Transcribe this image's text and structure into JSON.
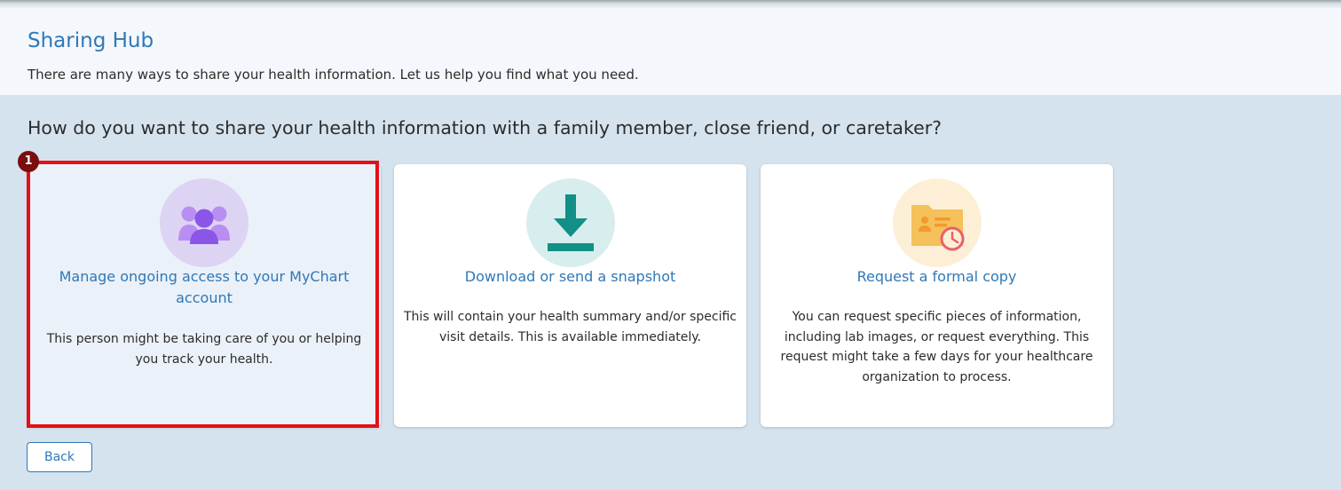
{
  "header": {
    "title": "Sharing Hub",
    "subtitle": "There are many ways to share your health information. Let us help you find what you need."
  },
  "question": "How do you want to share your health information with a family member, close friend, or caretaker?",
  "annotation": {
    "step_number": "1",
    "highlight_color": "#e41018"
  },
  "cards": [
    {
      "icon": "people-group-icon",
      "icon_bg": "#ddd4f3",
      "icon_color": "#8b55e8",
      "title": "Manage ongoing access to your MyChart account",
      "description": "This person might be taking care of you or helping you track your health."
    },
    {
      "icon": "download-icon",
      "icon_bg": "#d8eeee",
      "icon_color": "#128f86",
      "title": "Download or send a snapshot",
      "description": "This will contain your health summary and/or specific visit details. This is available immediately."
    },
    {
      "icon": "folder-clock-icon",
      "icon_bg": "#fdefd6",
      "icon_color": "#f4c15a",
      "title": "Request a formal copy",
      "description": "You can request specific pieces of information, including lab images, or request everything. This request might take a few days for your healthcare organization to process."
    }
  ],
  "back_label": "Back",
  "colors": {
    "accent": "#2f78b7",
    "page_bg": "#d5e3ef",
    "header_bg": "#f4f7fb"
  }
}
